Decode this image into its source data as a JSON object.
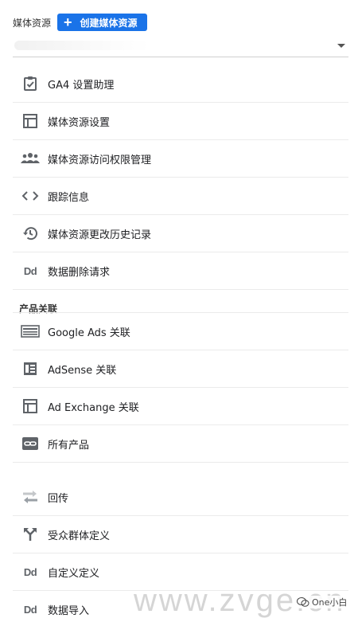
{
  "header": {
    "label": "媒体资源",
    "create_button": "创建媒体资源"
  },
  "property_selector": {
    "value": ""
  },
  "items_main": [
    {
      "label": "GA4 设置助理"
    },
    {
      "label": "媒体资源设置"
    },
    {
      "label": "媒体资源访问权限管理"
    },
    {
      "label": "跟踪信息"
    },
    {
      "label": "媒体资源更改历史记录"
    },
    {
      "label": "数据删除请求"
    }
  ],
  "section": {
    "product_links": "产品关联"
  },
  "items_links": [
    {
      "label": "Google Ads 关联"
    },
    {
      "label": "AdSense 关联"
    },
    {
      "label": "Ad Exchange 关联"
    },
    {
      "label": "所有产品"
    }
  ],
  "items_more": [
    {
      "label": "回传"
    },
    {
      "label": "受众群体定义"
    },
    {
      "label": "自定义定义"
    },
    {
      "label": "数据导入"
    }
  ],
  "icon_text": {
    "dd": "Dd"
  },
  "watermark": {
    "text": "www.zvge.cn",
    "badge": "One小白"
  },
  "colors": {
    "accent": "#1a73e8",
    "icon": "#5f6368",
    "divider": "#ebebeb"
  }
}
